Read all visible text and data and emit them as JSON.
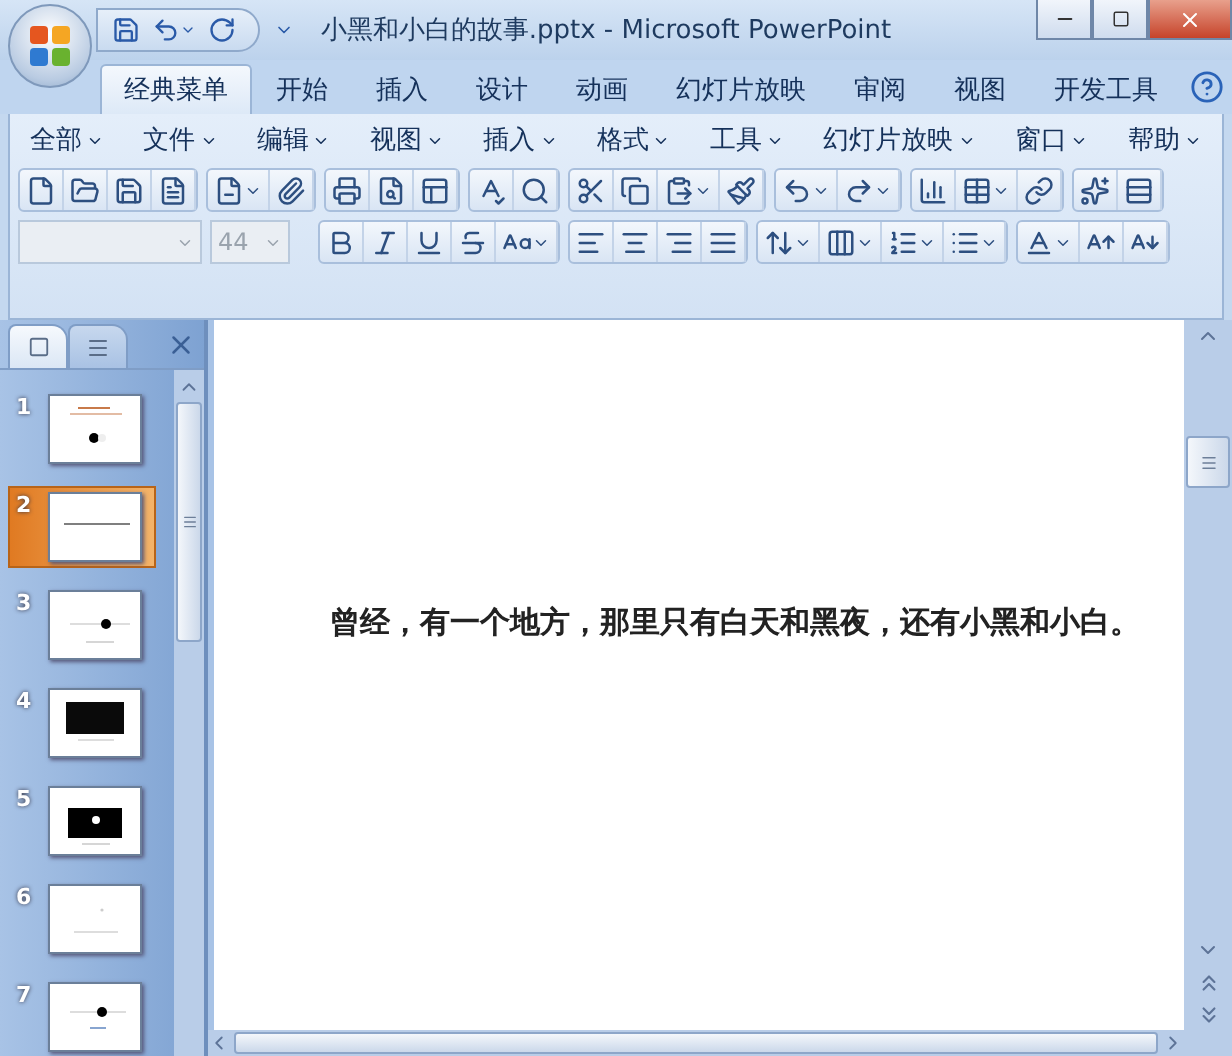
{
  "window": {
    "title": "小黑和小白的故事.pptx - Microsoft PowerPoint"
  },
  "ribbon_tabs": [
    {
      "label": "经典菜单",
      "selected": true
    },
    {
      "label": "开始",
      "selected": false
    },
    {
      "label": "插入",
      "selected": false
    },
    {
      "label": "设计",
      "selected": false
    },
    {
      "label": "动画",
      "selected": false
    },
    {
      "label": "幻灯片放映",
      "selected": false
    },
    {
      "label": "审阅",
      "selected": false
    },
    {
      "label": "视图",
      "selected": false
    },
    {
      "label": "开发工具",
      "selected": false
    }
  ],
  "menu_bar": [
    "全部",
    "文件",
    "编辑",
    "视图",
    "插入",
    "格式",
    "工具",
    "幻灯片放映",
    "窗口",
    "帮助"
  ],
  "font_name": {
    "disabled": true
  },
  "font_size": {
    "value": "44",
    "disabled": true
  },
  "pane_tabs": [
    {
      "kind": "slides",
      "selected": true
    },
    {
      "kind": "outline",
      "selected": false
    }
  ],
  "slides": [
    {
      "number": "1",
      "selected": false,
      "kind": "title-dot"
    },
    {
      "number": "2",
      "selected": true,
      "kind": "text"
    },
    {
      "number": "3",
      "selected": false,
      "kind": "line-dot"
    },
    {
      "number": "4",
      "selected": false,
      "kind": "black"
    },
    {
      "number": "5",
      "selected": false,
      "kind": "black-dot"
    },
    {
      "number": "6",
      "selected": false,
      "kind": "blank"
    },
    {
      "number": "7",
      "selected": false,
      "kind": "line-dot-caption"
    }
  ],
  "slide": {
    "text": "曾经，有一个地方，那里只有白天和黑夜，还有小黑和小白。"
  }
}
